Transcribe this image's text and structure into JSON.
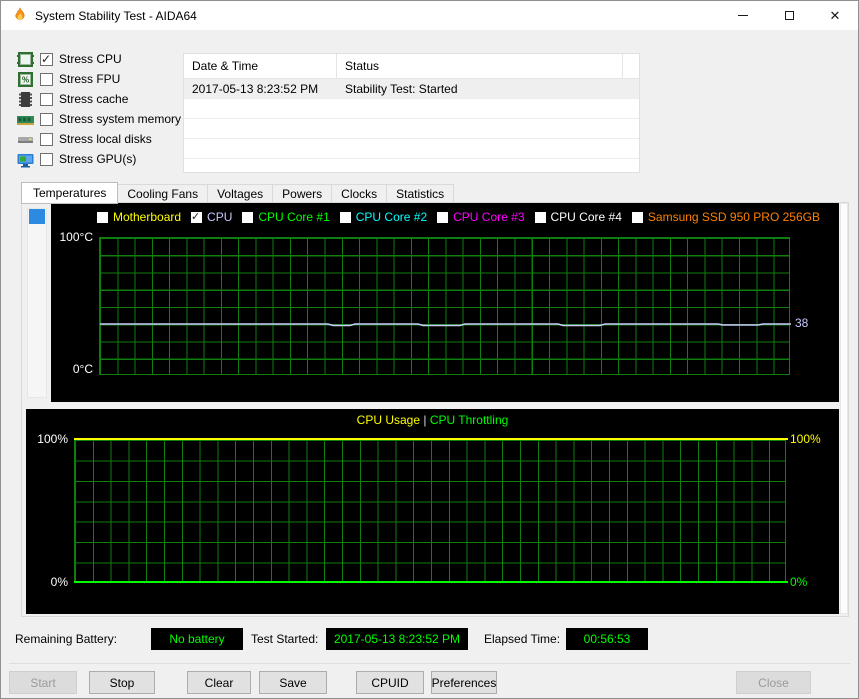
{
  "window": {
    "title": "System Stability Test - AIDA64",
    "controls": {
      "minimize": "minimize",
      "maximize": "maximize",
      "close": "close"
    }
  },
  "stress_options": {
    "items": [
      {
        "label": "Stress CPU",
        "checked": true,
        "icon": "cpu-chip-icon"
      },
      {
        "label": "Stress FPU",
        "checked": false,
        "icon": "fpu-chip-icon"
      },
      {
        "label": "Stress cache",
        "checked": false,
        "icon": "cache-chip-icon"
      },
      {
        "label": "Stress system memory",
        "checked": false,
        "icon": "memory-module-icon"
      },
      {
        "label": "Stress local disks",
        "checked": false,
        "icon": "hard-disk-icon"
      },
      {
        "label": "Stress GPU(s)",
        "checked": false,
        "icon": "gpu-monitor-icon"
      }
    ]
  },
  "log_table": {
    "columns": [
      "Date & Time",
      "Status"
    ],
    "rows": [
      {
        "datetime": "2017-05-13 8:23:52 PM",
        "status": "Stability Test: Started"
      }
    ]
  },
  "tabs": {
    "active": "Temperatures",
    "items": [
      "Temperatures",
      "Cooling Fans",
      "Voltages",
      "Powers",
      "Clocks",
      "Statistics"
    ]
  },
  "temperature_chart": {
    "legend": [
      {
        "label": "Motherboard",
        "checked": false,
        "color": "#ffff00"
      },
      {
        "label": "CPU",
        "checked": true,
        "color": "#c8c8ff"
      },
      {
        "label": "CPU Core #1",
        "checked": false,
        "color": "#00ff00"
      },
      {
        "label": "CPU Core #2",
        "checked": false,
        "color": "#00ffff"
      },
      {
        "label": "CPU Core #3",
        "checked": false,
        "color": "#ff00ff"
      },
      {
        "label": "CPU Core #4",
        "checked": false,
        "color": "#ffffff"
      },
      {
        "label": "Samsung SSD 950 PRO 256GB",
        "checked": false,
        "color": "#ff8000"
      }
    ],
    "y_max_label": "100°C",
    "y_min_label": "0°C",
    "current_value_label": "38",
    "series": [
      {
        "name": "CPU",
        "value_c": 38,
        "color": "#c8c8ff",
        "shape": "flat-line"
      }
    ],
    "grid_color": "#0e7e0e"
  },
  "usage_chart": {
    "title_primary": "CPU Usage",
    "title_separator": "|",
    "title_secondary": "CPU Throttling",
    "left_max_label": "100%",
    "left_min_label": "0%",
    "right_max_label": "100%",
    "right_min_label": "0%",
    "series": [
      {
        "name": "CPU Usage",
        "value_pct": 100,
        "color": "#ffff00",
        "shape": "flat-line"
      },
      {
        "name": "CPU Throttling",
        "value_pct": 0,
        "color": "#00ff00",
        "shape": "flat-line"
      }
    ],
    "grid_color": "#0e7e0e"
  },
  "status_bar": {
    "battery_label": "Remaining Battery:",
    "battery_value": "No battery",
    "test_started_label": "Test Started:",
    "test_started_value": "2017-05-13 8:23:52 PM",
    "elapsed_label": "Elapsed Time:",
    "elapsed_value": "00:56:53",
    "value_color": "#00ff00"
  },
  "buttons": {
    "start": {
      "label": "Start",
      "disabled": true
    },
    "stop": {
      "label": "Stop",
      "disabled": false
    },
    "clear": {
      "label": "Clear",
      "disabled": false
    },
    "save": {
      "label": "Save",
      "disabled": false
    },
    "cpuid": {
      "label": "CPUID",
      "disabled": false
    },
    "preferences": {
      "label": "Preferences",
      "disabled": false
    },
    "close": {
      "label": "Close",
      "disabled": true
    }
  }
}
